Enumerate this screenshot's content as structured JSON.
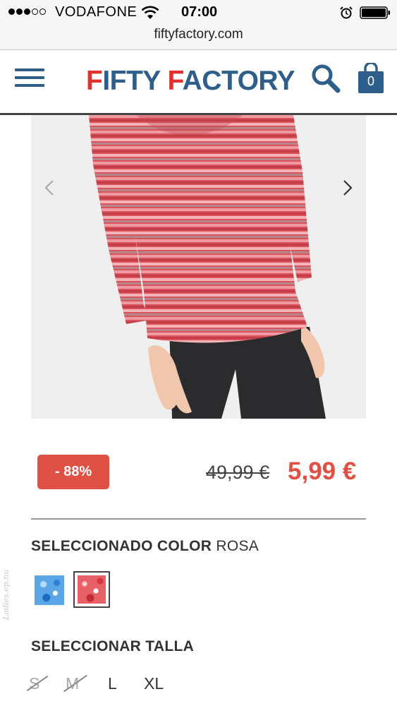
{
  "status_bar": {
    "carrier": "VODAFONE",
    "time": "07:00",
    "signal_bars_filled": 3,
    "signal_bars_total": 5
  },
  "browser": {
    "url": "fiftyfactory.com"
  },
  "header": {
    "logo_part1_initial": "F",
    "logo_part1_rest": "IFTY ",
    "logo_part2_initial": "F",
    "logo_part2_rest": "ACTORY",
    "cart_count": "0",
    "brand_red": "#e0312e",
    "brand_blue": "#2e5e8a"
  },
  "product": {
    "discount_badge": "- 88%",
    "old_price": "49,99 €",
    "new_price": "5,99 €",
    "price_color": "#e05145",
    "color_label": "SELECCIONADO COLOR",
    "color_value": "ROSA",
    "swatches": [
      {
        "name": "azul",
        "selected": false
      },
      {
        "name": "rosa",
        "selected": true
      }
    ],
    "size_label": "SELECCIONAR TALLA",
    "sizes": [
      {
        "label": "S",
        "available": false
      },
      {
        "label": "M",
        "available": false
      },
      {
        "label": "L",
        "available": true
      },
      {
        "label": "XL",
        "available": true
      }
    ]
  },
  "watermark": "Ladies.ep.nu",
  "icons": [
    "wifi-icon",
    "alarm-icon",
    "battery-icon",
    "menu-icon",
    "search-icon",
    "shopping-bag-icon",
    "chevron-left-icon",
    "chevron-right-icon"
  ]
}
